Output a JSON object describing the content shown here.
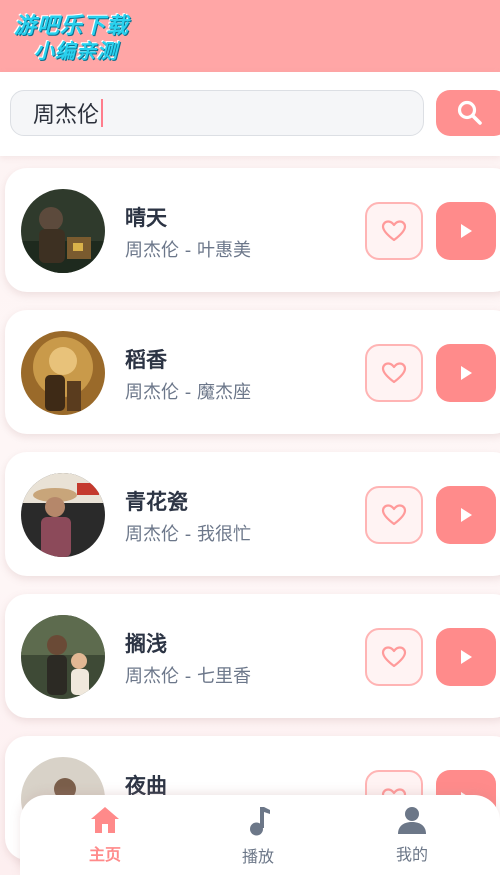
{
  "watermark": {
    "line1": "游吧乐下载",
    "line2": "小编亲测"
  },
  "search": {
    "value": "周杰伦"
  },
  "songs": [
    {
      "title": "晴天",
      "subtitle": "周杰伦 - 叶惠美"
    },
    {
      "title": "稻香",
      "subtitle": "周杰伦 - 魔杰座"
    },
    {
      "title": "青花瓷",
      "subtitle": "周杰伦 - 我很忙"
    },
    {
      "title": "搁浅",
      "subtitle": "周杰伦 - 七里香"
    },
    {
      "title": "夜曲",
      "subtitle": ""
    }
  ],
  "nav": {
    "items": [
      {
        "label": "主页",
        "icon": "home-icon",
        "active": true
      },
      {
        "label": "播放",
        "icon": "music-note-icon",
        "active": false
      },
      {
        "label": "我的",
        "icon": "user-icon",
        "active": false
      }
    ]
  },
  "colors": {
    "header_bg": "#ffa6a6",
    "accent": "#ff8b8b",
    "active_nav": "#ff8a8a",
    "title_text": "#2c3444",
    "subtitle_text": "#6c778a"
  }
}
